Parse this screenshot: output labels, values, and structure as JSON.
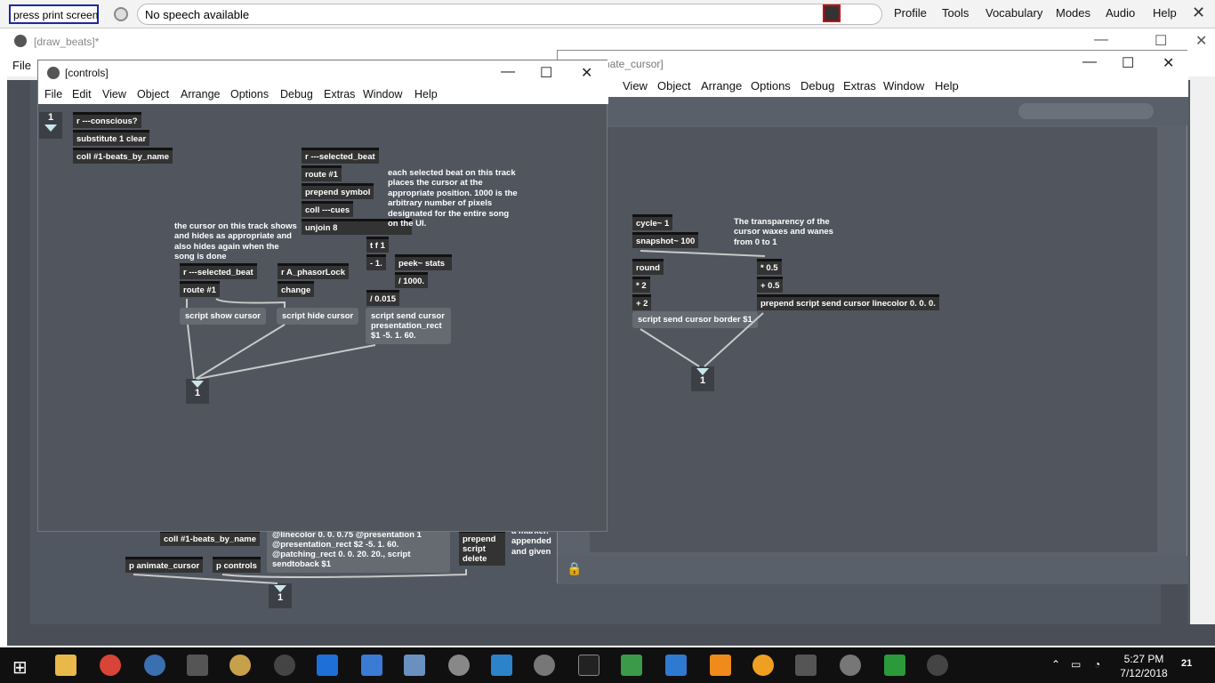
{
  "dragon_bar": {
    "command_field": "press print screen",
    "speech_status": "No speech available",
    "menu": [
      "Profile",
      "Tools",
      "Vocabulary",
      "Modes",
      "Audio",
      "Help"
    ]
  },
  "background_window": {
    "title": "[draw_beats]*",
    "menu_first": "File"
  },
  "animate_window": {
    "title": "[animate_cursor]",
    "title_visible": "nate_cursor]",
    "menu": [
      "t",
      "View",
      "Object",
      "Arrange",
      "Options",
      "Debug",
      "Extras",
      "Window",
      "Help"
    ],
    "objects": {
      "cycle": "cycle~ 1",
      "snapshot": "snapshot~ 100",
      "round": "round",
      "mul2": "* 2",
      "add2": "+ 2",
      "mul05": "* 0.5",
      "add05": "+ 0.5",
      "prepend": "prepend script send cursor linecolor 0. 0. 0.",
      "border_msg": "script send cursor border $1",
      "comment": "The transparency of the cursor waxes and wanes from 0 to 1",
      "outlet": "1"
    }
  },
  "controls_window": {
    "title": "[controls]",
    "menu": [
      "File",
      "Edit",
      "View",
      "Object",
      "Arrange",
      "Options",
      "Debug",
      "Extras",
      "Window",
      "Help"
    ],
    "inlet_number": "1",
    "objects": {
      "conscious": "r ---conscious?",
      "substitute": "substitute 1 clear",
      "coll_beats": "coll #1-beats_by_name",
      "r_selected": "r ---selected_beat",
      "route1": "route #1",
      "prepend_symbol": "prepend symbol",
      "coll_cues": "coll ---cues",
      "unjoin": "unjoin 8",
      "tf1": "t f 1",
      "minus1": "- 1.",
      "peek": "peek~ stats",
      "div1000": "/ 1000.",
      "div015": "/ 0.015",
      "r_selected2": "r ---selected_beat",
      "route1b": "route #1",
      "phasor": "r A_phasorLock",
      "change": "change",
      "show_msg": "script show cursor",
      "hide_msg": "script hide cursor",
      "rect_msg": "script send cursor presentation_rect $1 -5. 1. 60.",
      "outlet": "1"
    },
    "comments": {
      "beat": "each selected beat on this track places the cursor at the appropriate position. 1000 is the arbitrary number of pixels designated for the entire song on the UI.",
      "cursor": "the cursor on this track shows and hides as appropriate and also hides again when the song is done"
    }
  },
  "bg_patch": {
    "coll_beats": "coll #1-beats_by_name",
    "animate_cursor": "p animate_cursor",
    "controls": "p controls",
    "long_msg": "@linecolor 0. 0. 0.75 @presentation 1 @presentation_rect $2 -5. 1. 60. @patching_rect 0. 0. 20. 20., script sendtoback $1",
    "prepend_delete": "prepend script delete",
    "marker_comment": "a marker. appended and given",
    "outlet": "1"
  },
  "taskbar": {
    "time": "5:27 PM",
    "date": "7/12/2018",
    "notifications": "21"
  }
}
